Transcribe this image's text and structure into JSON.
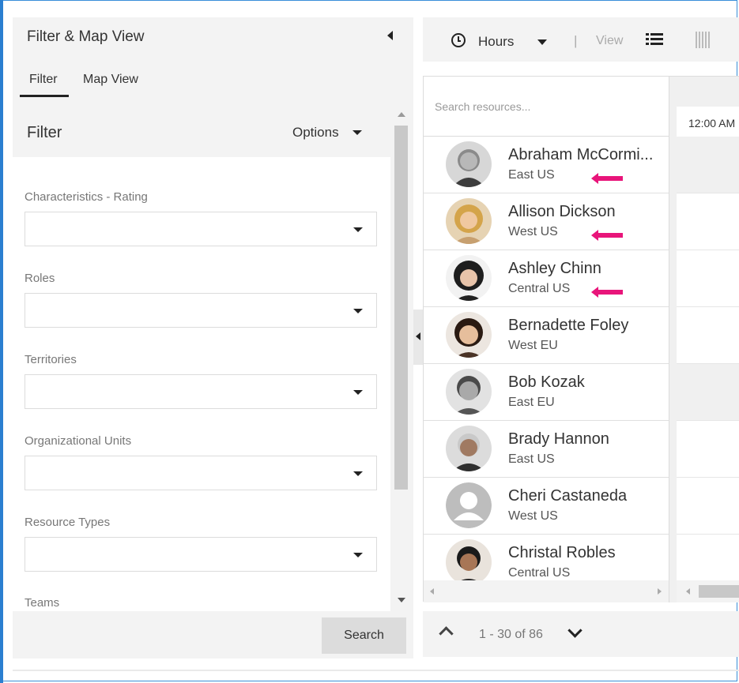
{
  "left_panel": {
    "title": "Filter & Map View",
    "tabs": [
      {
        "label": "Filter"
      },
      {
        "label": "Map View"
      }
    ],
    "filter_header": {
      "title": "Filter",
      "options_label": "Options"
    },
    "fields": [
      {
        "label": "Characteristics - Rating",
        "value": ""
      },
      {
        "label": "Roles",
        "value": ""
      },
      {
        "label": "Territories",
        "value": ""
      },
      {
        "label": "Organizational Units",
        "value": ""
      },
      {
        "label": "Resource Types",
        "value": ""
      },
      {
        "label": "Teams",
        "value": ""
      }
    ],
    "search_button": "Search"
  },
  "toolbar": {
    "time_scale": "Hours",
    "separator": "|",
    "view_label": "View"
  },
  "resources": {
    "search_placeholder": "Search resources...",
    "timeline_label": "12:00 AM",
    "items": [
      {
        "name": "Abraham McCormi...",
        "region": "East US",
        "avatar": "avatar-abraham",
        "arrow": true
      },
      {
        "name": "Allison Dickson",
        "region": "West US",
        "avatar": "avatar-allison",
        "arrow": true
      },
      {
        "name": "Ashley Chinn",
        "region": "Central US",
        "avatar": "avatar-ashley",
        "arrow": true
      },
      {
        "name": "Bernadette Foley",
        "region": "West EU",
        "avatar": "avatar-bernadette",
        "arrow": false
      },
      {
        "name": "Bob Kozak",
        "region": "East EU",
        "avatar": "avatar-bob",
        "arrow": false
      },
      {
        "name": "Brady Hannon",
        "region": "East US",
        "avatar": "avatar-brady",
        "arrow": false
      },
      {
        "name": "Cheri Castaneda",
        "region": "West US",
        "avatar": "default-user-icon",
        "arrow": false
      },
      {
        "name": "Christal Robles",
        "region": "Central US",
        "avatar": "avatar-christal",
        "arrow": false
      }
    ]
  },
  "pager": {
    "range_text": "1 - 30 of 86"
  },
  "colors": {
    "accent_arrow": "#e8157a",
    "frame_border": "#3a8fd9"
  }
}
